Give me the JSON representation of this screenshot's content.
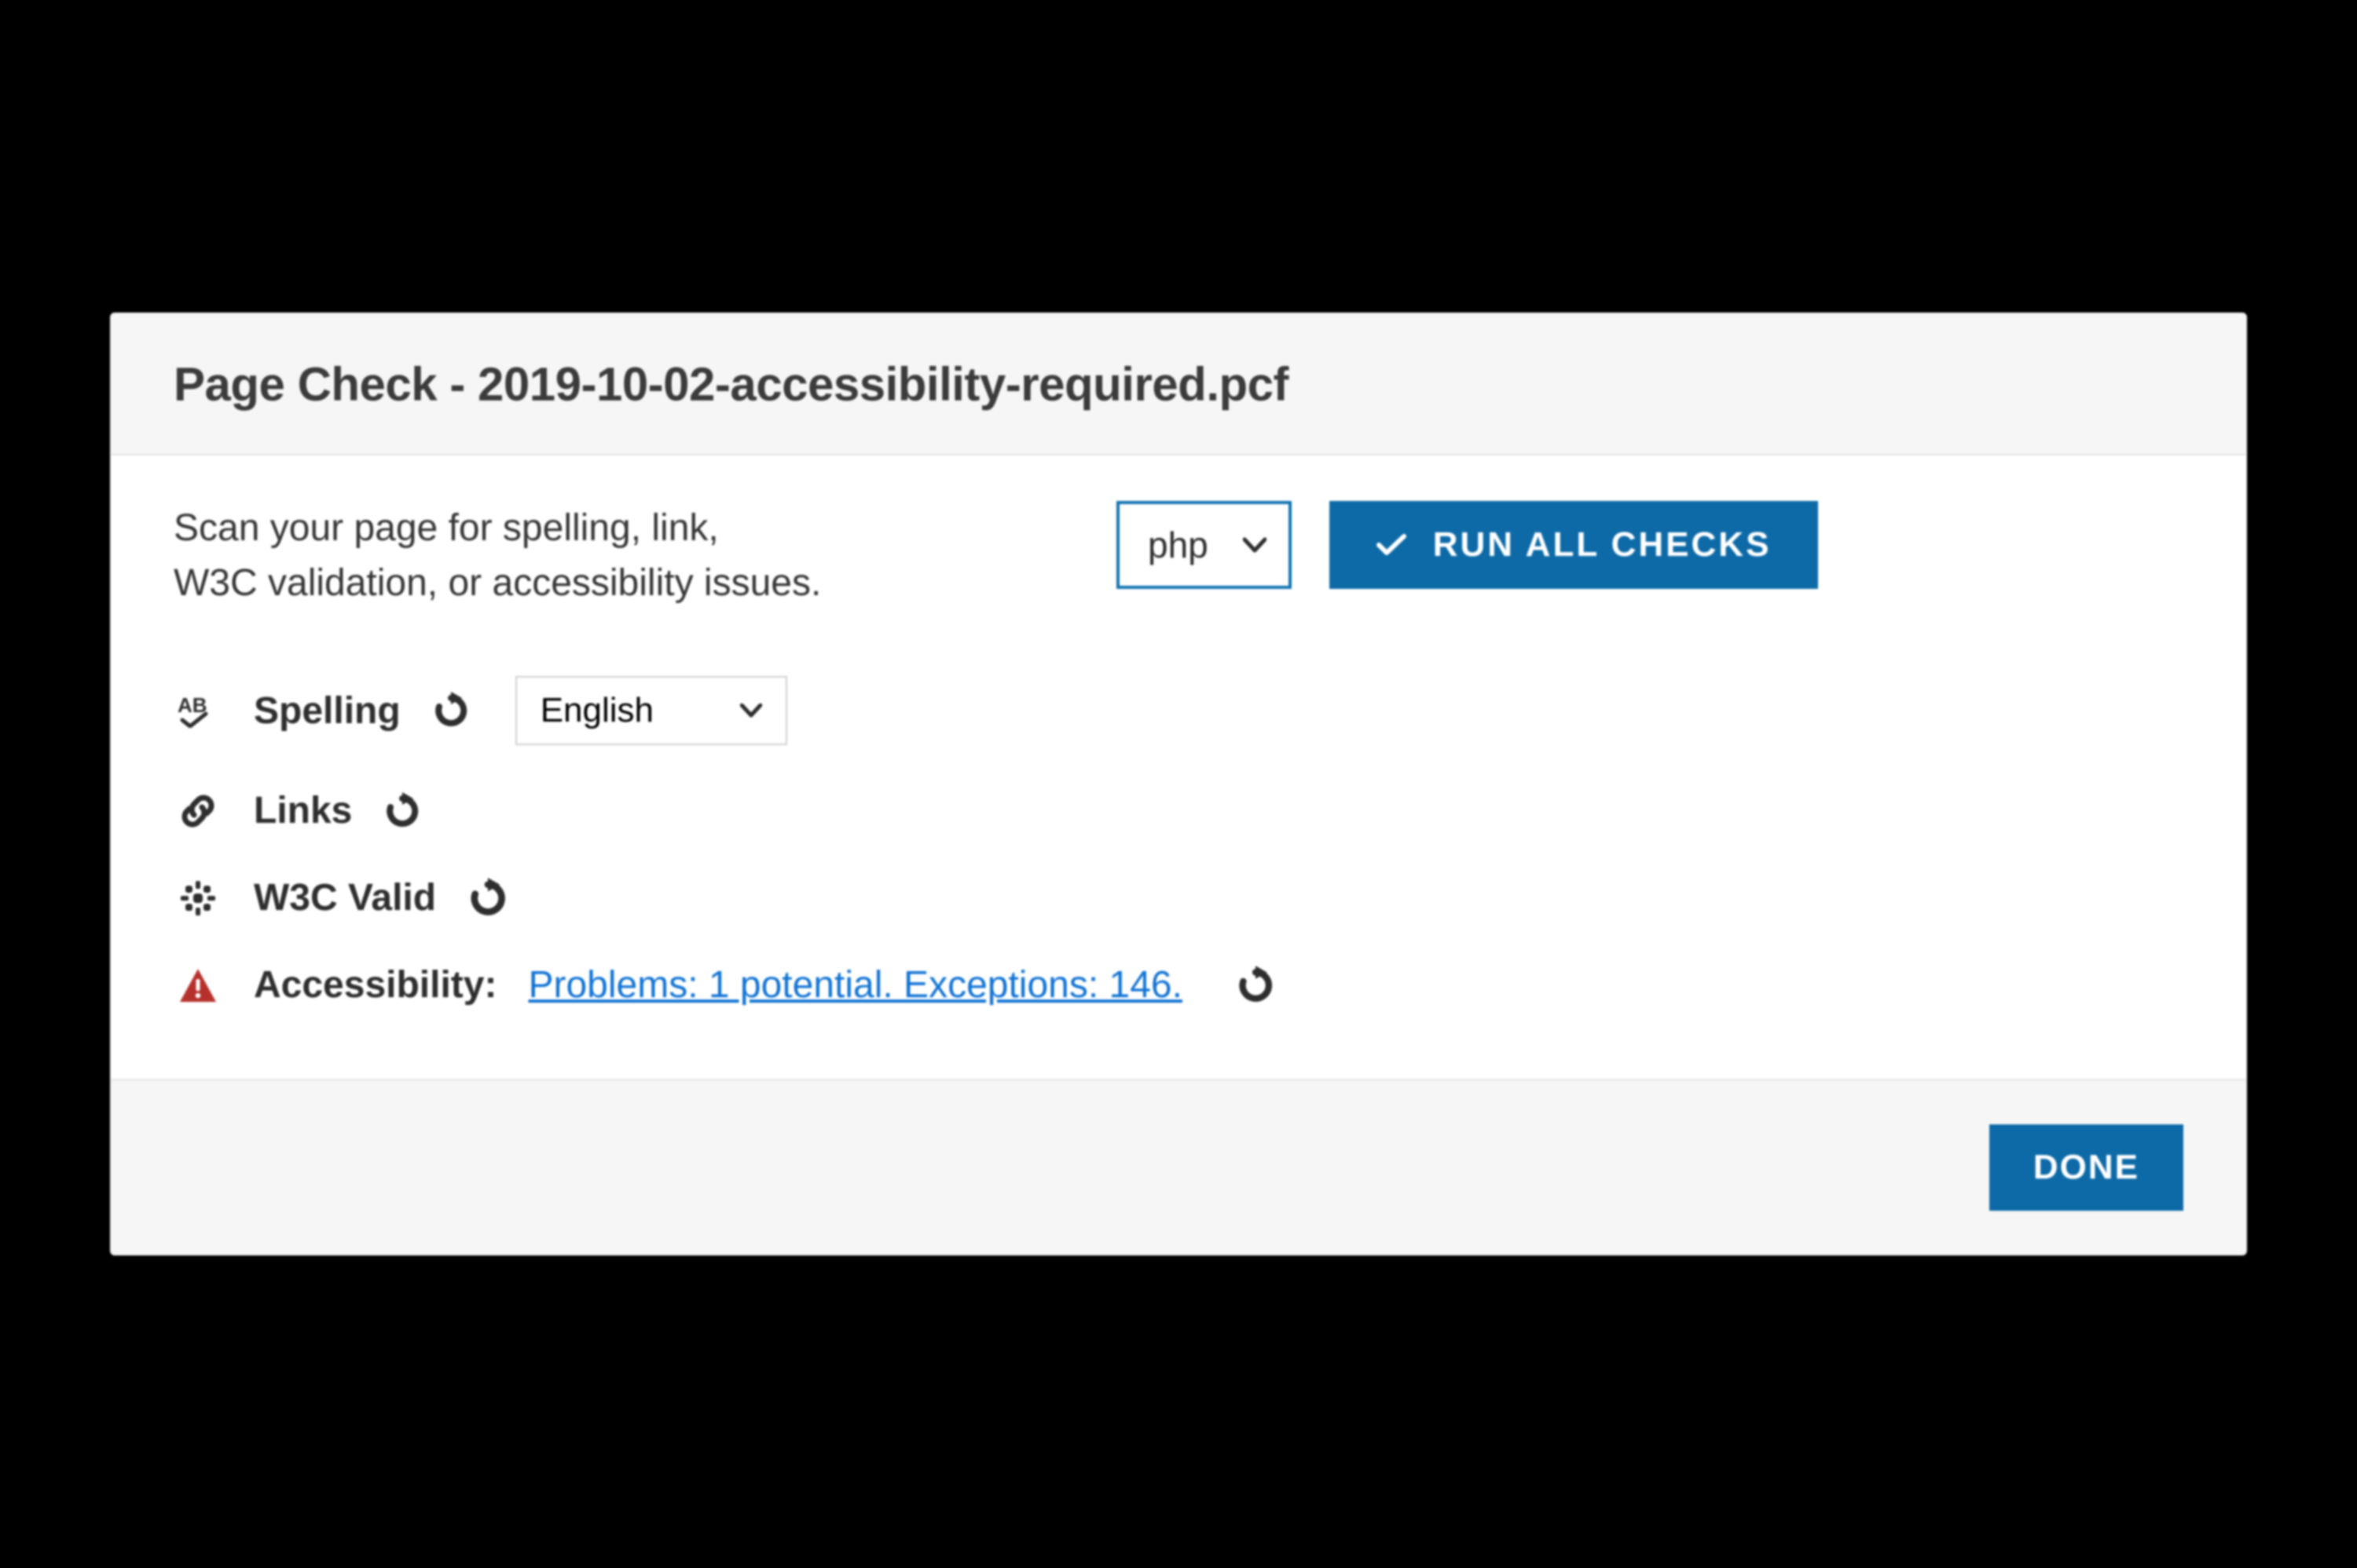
{
  "header": {
    "title": "Page Check - 2019-10-02-accessibility-required.pcf"
  },
  "body": {
    "instructions_line1": "Scan your page for spelling, link,",
    "instructions_line2": "W3C validation, or accessibility issues.",
    "format_select": {
      "value": "php"
    },
    "run_button": "RUN ALL CHECKS"
  },
  "checks": {
    "spelling": {
      "label": "Spelling",
      "language": "English"
    },
    "links": {
      "label": "Links"
    },
    "w3c": {
      "label": "W3C Valid"
    },
    "accessibility": {
      "label": "Accessibility:",
      "result": "Problems: 1 potential. Exceptions: 146."
    }
  },
  "footer": {
    "done": "DONE"
  }
}
